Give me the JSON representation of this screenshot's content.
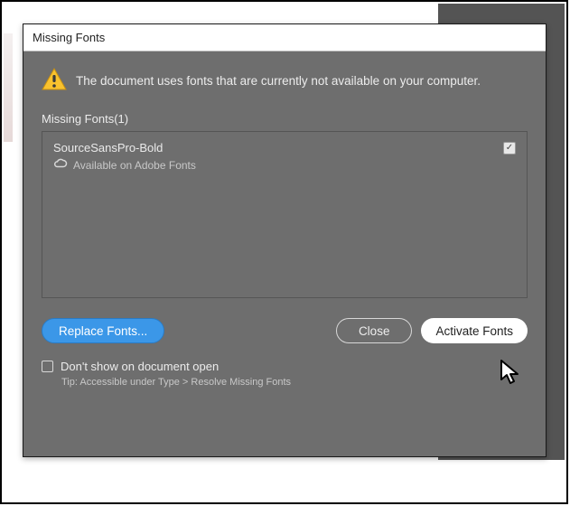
{
  "dialog": {
    "title": "Missing Fonts",
    "warning_text": "The document uses fonts that are currently not available on your computer.",
    "section_label": "Missing Fonts(1)",
    "font_entry": {
      "name": "SourceSansPro-Bold",
      "sub_text": "Available on Adobe Fonts",
      "checked": "✓"
    },
    "buttons": {
      "replace": "Replace Fonts...",
      "close": "Close",
      "activate": "Activate Fonts"
    },
    "dont_show_label": "Don't show on document open",
    "tip_text": "Tip: Accessible under Type > Resolve Missing Fonts"
  }
}
